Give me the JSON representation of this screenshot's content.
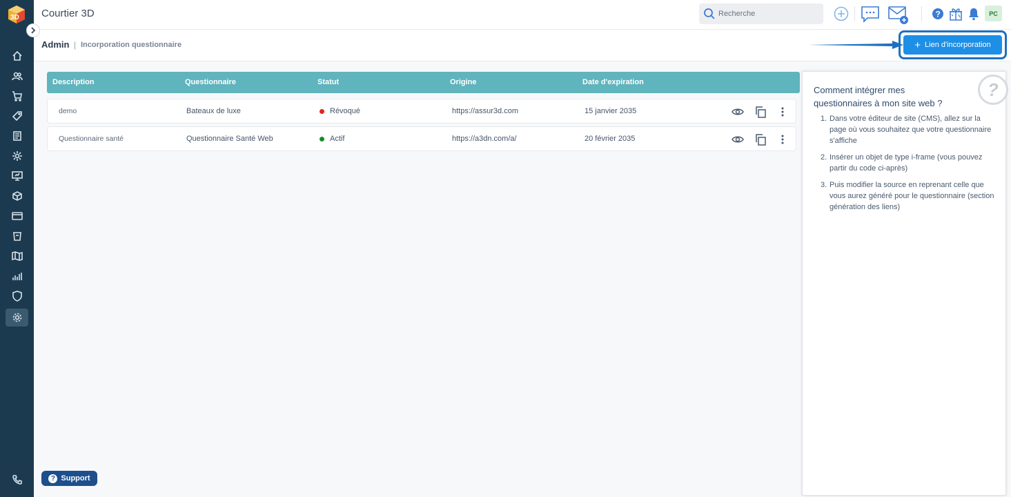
{
  "app": {
    "title": "Courtier 3D"
  },
  "header": {
    "search_placeholder": "Recherche",
    "avatar_initials": "PC"
  },
  "breadcrumb": {
    "root": "Admin",
    "separator": "|",
    "leaf": "Incorporation questionnaire"
  },
  "toolbar": {
    "add_link_label": "Lien d'incorporation"
  },
  "table": {
    "columns": [
      "Description",
      "Questionnaire",
      "Statut",
      "Origine",
      "Date d'expiration"
    ],
    "rows": [
      {
        "description": "demo",
        "questionnaire": "Bateaux de luxe",
        "status": "Révoqué",
        "status_color": "#e02424",
        "origin": "https://assur3d.com",
        "expiration": "15 janvier 2035"
      },
      {
        "description": "Questionnaire santé",
        "questionnaire": "Questionnaire Santé Web",
        "status": "Actif",
        "status_color": "#1a8a2a",
        "origin": "https://a3dn.com/a/",
        "expiration": "20 février 2035"
      }
    ]
  },
  "help": {
    "title": "Comment intégrer mes questionnaires à mon site web ?",
    "badge": "?",
    "steps": [
      {
        "n": "1.",
        "text": "Dans votre éditeur de site (CMS), allez sur la page où vous souhaitez que votre questionnaire s'affiche"
      },
      {
        "n": "2.",
        "text": "Insérer un objet de type i-frame (vous pouvez partir du code ci-après)"
      },
      {
        "n": "3.",
        "text": "Puis modifier la source en reprenant celle que vous aurez généré pour le questionnaire (section génération des liens)"
      }
    ]
  },
  "support": {
    "label": "Support",
    "icon": "?"
  },
  "colors": {
    "sidebar": "#1c3a4f",
    "table_header": "#5fb4bd",
    "primary_button": "#1e8fe6",
    "support_button": "#1d4f8c"
  },
  "icons": {
    "sidebar": [
      "home-icon",
      "users-icon",
      "cart-icon",
      "tag-icon",
      "document-icon",
      "gear-cog-icon",
      "presentation-icon",
      "box-icon",
      "card-icon",
      "cup-icon",
      "map-icon",
      "chart-icon",
      "shield-icon",
      "settings-icon"
    ],
    "header": [
      "search-icon",
      "plus-circle-icon",
      "chat-icon",
      "mail-add-icon",
      "help-icon",
      "gift-icon",
      "bell-icon"
    ]
  }
}
